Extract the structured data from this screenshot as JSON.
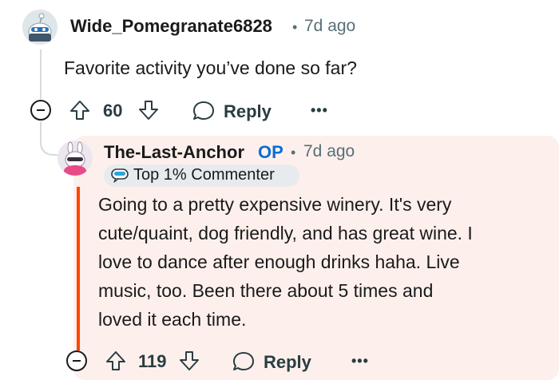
{
  "parent_comment": {
    "username": "Wide_Pomegranate6828",
    "separator": "•",
    "time": "7d ago",
    "body": "Favorite activity you’ve done so far?",
    "score": "60",
    "reply_label": "Reply",
    "more_label": "•••"
  },
  "reply_comment": {
    "username": "The-Last-Anchor",
    "op_label": "OP",
    "separator": "•",
    "time": "7d ago",
    "badge_label": "Top 1% Commenter",
    "body_lines": [
      "Going to a pretty expensive winery. It's very",
      "cute/quaint, dog friendly, and has great wine. I",
      "love to dance after enough drinks haha. Live",
      "music, too. Been there about 5 times and",
      "loved it each time."
    ],
    "score": "119",
    "reply_label": "Reply",
    "more_label": "•••"
  },
  "colors": {
    "reply_background": "#fdf0ec",
    "op_blue": "#0a6ed1",
    "highlight_line": "#ff4500"
  }
}
